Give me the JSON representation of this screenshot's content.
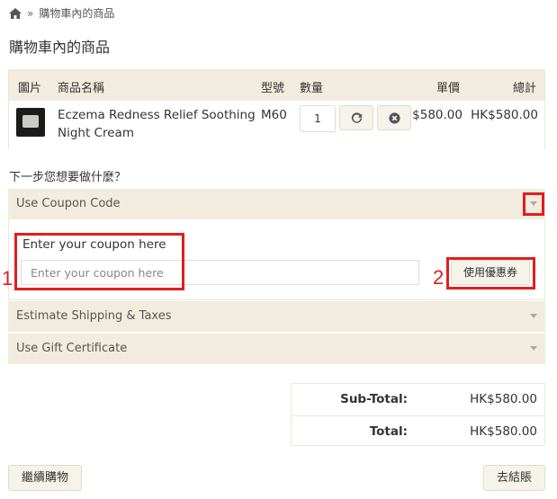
{
  "breadcrumb": {
    "current": "購物車內的商品"
  },
  "page_title": "購物車內的商品",
  "cart": {
    "headers": {
      "image": "圖片",
      "name": "商品名稱",
      "model": "型號",
      "quantity": "數量",
      "unit_price": "單價",
      "total": "總計"
    },
    "items": [
      {
        "name": "Eczema Redness Relief Soothing Night Cream",
        "model": "M60",
        "quantity": "1",
        "unit_price": "HK$580.00",
        "total": "HK$580.00"
      }
    ]
  },
  "next_step": "下一步您想要做什麼？",
  "panels": {
    "coupon": {
      "title": "Use Coupon Code",
      "label": "Enter your coupon here",
      "placeholder": "Enter your coupon here",
      "button": "使用優惠券"
    },
    "shipping": {
      "title": "Estimate Shipping & Taxes"
    },
    "gift": {
      "title": "Use Gift Certificate"
    }
  },
  "annotations": {
    "mark1": "1",
    "mark2": "2"
  },
  "totals": [
    {
      "label": "Sub-Total:",
      "value": "HK$580.00"
    },
    {
      "label": "Total:",
      "value": "HK$580.00"
    }
  ],
  "buttons": {
    "continue": "繼續購物",
    "checkout": "去結賬"
  },
  "colors": {
    "panel_bg": "#f1ecdd",
    "highlight": "#e01e1e"
  }
}
